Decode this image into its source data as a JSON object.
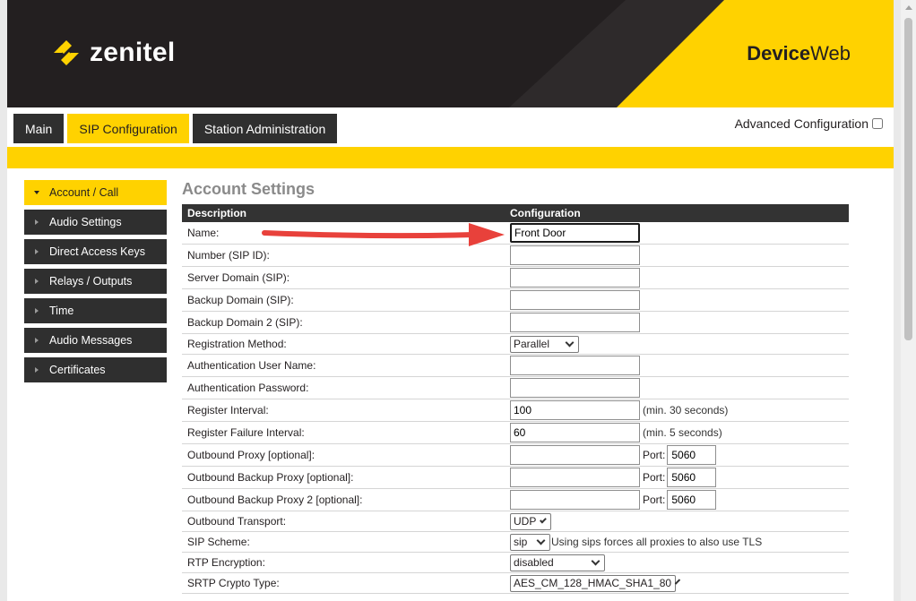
{
  "header": {
    "brand": "zenitel",
    "product_bold": "Device",
    "product_rest": "Web"
  },
  "tabs": [
    {
      "label": "Main",
      "active": false
    },
    {
      "label": "SIP Configuration",
      "active": true
    },
    {
      "label": "Station Administration",
      "active": false
    }
  ],
  "advanced": {
    "label": "Advanced Configuration",
    "checked": false
  },
  "sidebar": {
    "items": [
      {
        "label": "Account / Call",
        "active": true
      },
      {
        "label": "Audio Settings",
        "active": false
      },
      {
        "label": "Direct Access Keys",
        "active": false
      },
      {
        "label": "Relays / Outputs",
        "active": false
      },
      {
        "label": "Time",
        "active": false
      },
      {
        "label": "Audio Messages",
        "active": false
      },
      {
        "label": "Certificates",
        "active": false
      }
    ]
  },
  "main": {
    "title": "Account Settings",
    "col_description": "Description",
    "col_configuration": "Configuration",
    "rows": {
      "name": {
        "label": "Name:",
        "value": "Front Door"
      },
      "number": {
        "label": "Number (SIP ID):",
        "value": ""
      },
      "server_domain": {
        "label": "Server Domain (SIP):",
        "value": ""
      },
      "backup_domain": {
        "label": "Backup Domain (SIP):",
        "value": ""
      },
      "backup_domain2": {
        "label": "Backup Domain 2 (SIP):",
        "value": ""
      },
      "registration_method": {
        "label": "Registration Method:",
        "value": "Parallel"
      },
      "auth_user": {
        "label": "Authentication User Name:",
        "value": ""
      },
      "auth_pass": {
        "label": "Authentication Password:",
        "value": ""
      },
      "register_interval": {
        "label": "Register Interval:",
        "value": "100",
        "hint": "(min. 30 seconds)"
      },
      "register_failure": {
        "label": "Register Failure Interval:",
        "value": "60",
        "hint": "(min. 5 seconds)"
      },
      "outbound_proxy": {
        "label": "Outbound Proxy [optional]:",
        "value": "",
        "port_label": "Port:",
        "port": "5060"
      },
      "outbound_backup": {
        "label": "Outbound Backup Proxy [optional]:",
        "value": "",
        "port_label": "Port:",
        "port": "5060"
      },
      "outbound_backup2": {
        "label": "Outbound Backup Proxy 2 [optional]:",
        "value": "",
        "port_label": "Port:",
        "port": "5060"
      },
      "outbound_transport": {
        "label": "Outbound Transport:",
        "value": "UDP"
      },
      "sip_scheme": {
        "label": "SIP Scheme:",
        "value": "sip",
        "hint": "Using sips forces all proxies to also use TLS"
      },
      "rtp_encryption": {
        "label": "RTP Encryption:",
        "value": "disabled"
      },
      "srtp_crypto": {
        "label": "SRTP Crypto Type:",
        "value": "AES_CM_128_HMAC_SHA1_80"
      }
    }
  },
  "colors": {
    "brand_yellow": "#ffd200",
    "dark": "#231f20",
    "annotation_arrow": "#e8413b"
  }
}
